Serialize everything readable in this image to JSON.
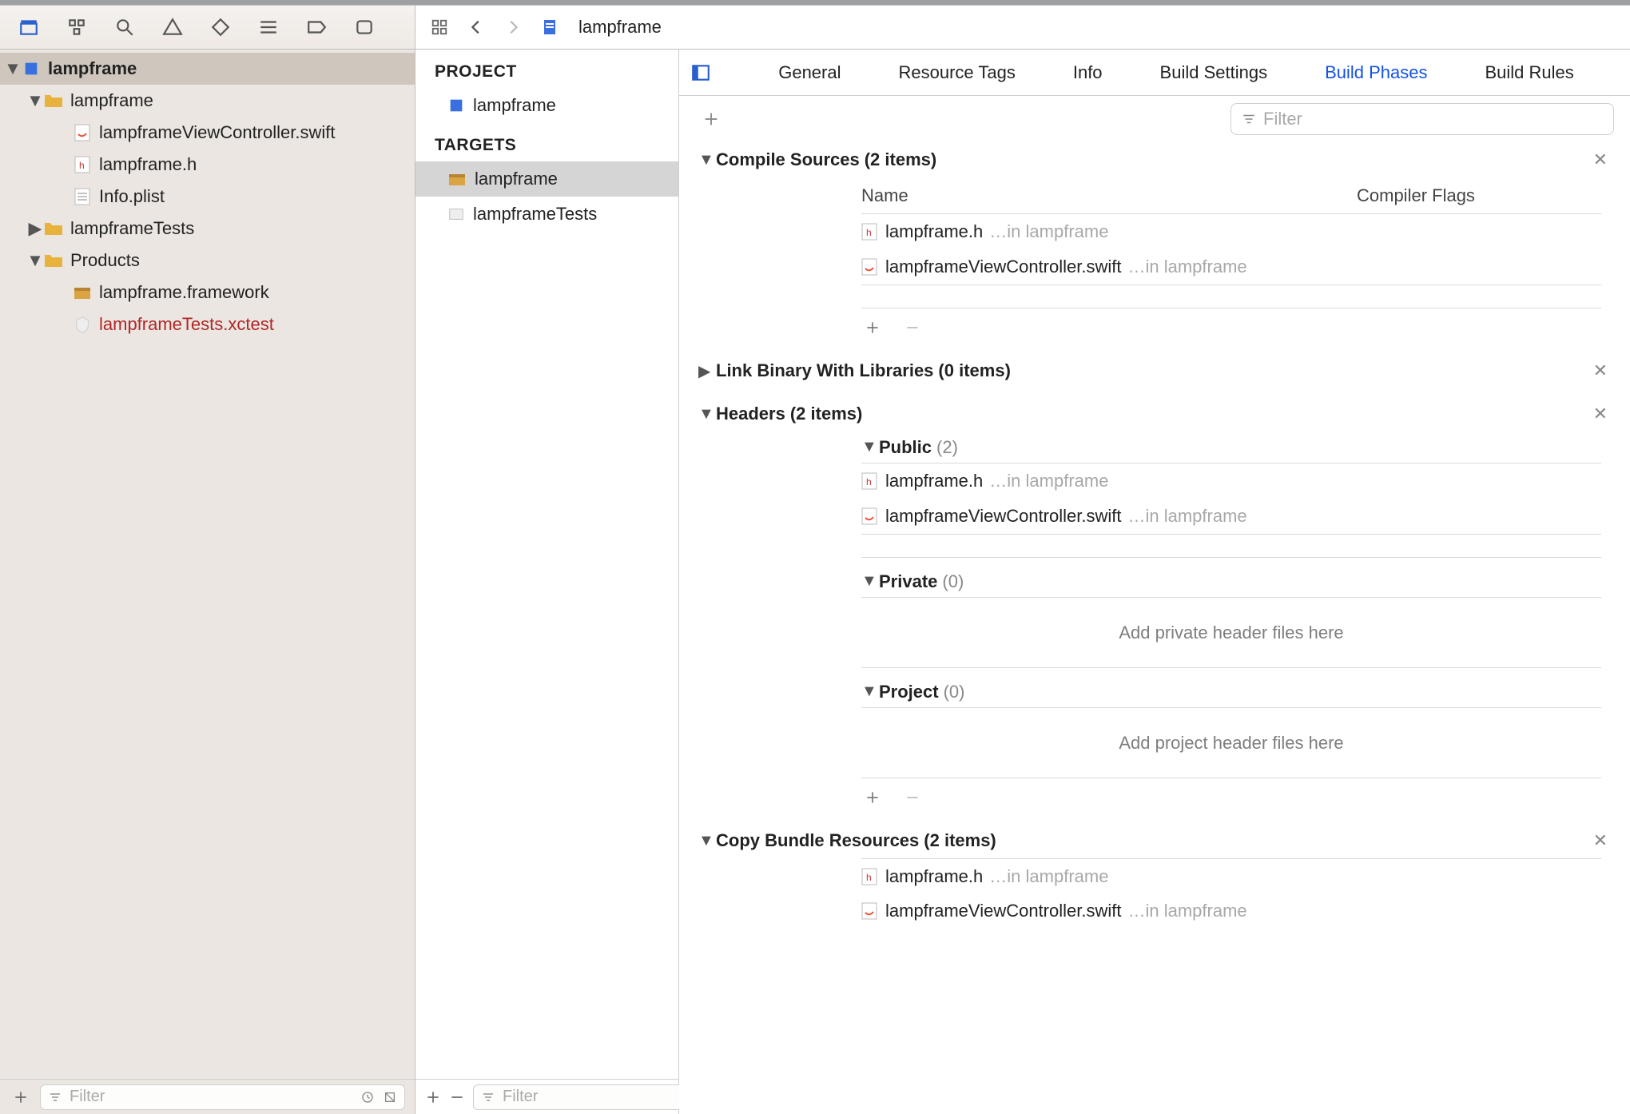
{
  "toolbar": {
    "doc_title": "lampframe"
  },
  "navigator": {
    "project": "lampframe",
    "tree": {
      "lampframe_folder": "lampframe",
      "file_swift": "lampframeViewController.swift",
      "file_h": "lampframe.h",
      "file_plist": "Info.plist",
      "tests_folder": "lampframeTests",
      "products_folder": "Products",
      "framework": "lampframe.framework",
      "xctest": "lampframeTests.xctest"
    },
    "filter_placeholder": "Filter"
  },
  "mid": {
    "project_heading": "PROJECT",
    "project_item": "lampframe",
    "targets_heading": "TARGETS",
    "target_framework": "lampframe",
    "target_tests": "lampframeTests",
    "filter_placeholder": "Filter"
  },
  "tabs": {
    "general": "General",
    "resource_tags": "Resource Tags",
    "info": "Info",
    "build_settings": "Build Settings",
    "build_phases": "Build Phases",
    "build_rules": "Build Rules"
  },
  "phase_tools": {
    "filter_placeholder": "Filter"
  },
  "phases": {
    "compile": {
      "title": "Compile Sources",
      "count": "(2 items)",
      "col_name": "Name",
      "col_flags": "Compiler Flags",
      "rows": [
        {
          "file": "lampframe.h",
          "loc": "…in lampframe"
        },
        {
          "file": "lampframeViewController.swift",
          "loc": "…in lampframe"
        }
      ]
    },
    "link": {
      "title": "Link Binary With Libraries",
      "count": "(0 items)"
    },
    "headers": {
      "title": "Headers",
      "count": "(2 items)",
      "public": {
        "title": "Public",
        "count": "(2)",
        "rows": [
          {
            "file": "lampframe.h",
            "loc": "…in lampframe"
          },
          {
            "file": "lampframeViewController.swift",
            "loc": "…in lampframe"
          }
        ]
      },
      "private": {
        "title": "Private",
        "count": "(0)",
        "hint": "Add private header files here"
      },
      "project": {
        "title": "Project",
        "count": "(0)",
        "hint": "Add project header files here"
      }
    },
    "copy": {
      "title": "Copy Bundle Resources",
      "count": "(2 items)",
      "rows": [
        {
          "file": "lampframe.h",
          "loc": "…in lampframe"
        },
        {
          "file": "lampframeViewController.swift",
          "loc": "…in lampframe"
        }
      ]
    }
  }
}
